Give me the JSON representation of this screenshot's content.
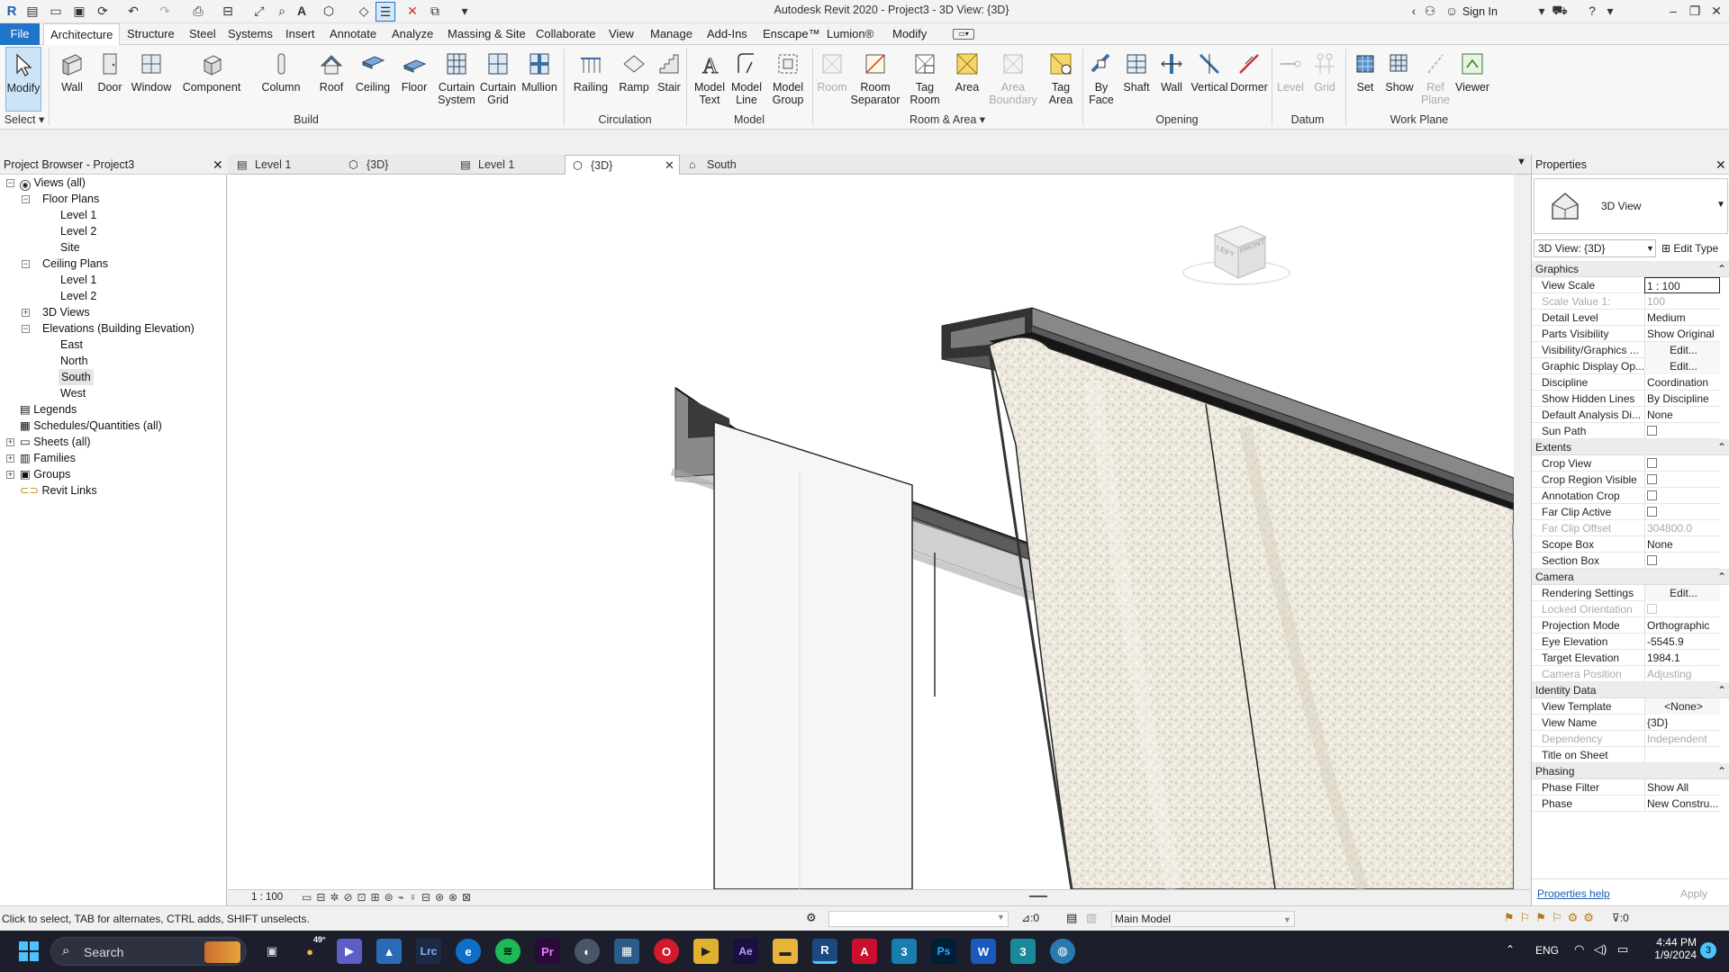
{
  "app": {
    "title": "Autodesk Revit 2020 - Project3 - 3D View: {3D}",
    "sign_in": "Sign In"
  },
  "menu": {
    "items": [
      "File",
      "Architecture",
      "Structure",
      "Steel",
      "Systems",
      "Insert",
      "Annotate",
      "Analyze",
      "Massing & Site",
      "Collaborate",
      "View",
      "Manage",
      "Add-Ins",
      "Enscape™",
      "Lumion®",
      "Modify"
    ]
  },
  "ribbon": {
    "buttons": [
      {
        "label": "Modify",
        "icon": "cursor-arrow-icon"
      },
      {
        "label": "Wall",
        "icon": "wall-icon"
      },
      {
        "label": "Door",
        "icon": "door-icon"
      },
      {
        "label": "Window",
        "icon": "window-icon"
      },
      {
        "label": "Component",
        "icon": "component-icon"
      },
      {
        "label": "Column",
        "icon": "column-icon"
      },
      {
        "label": "Roof",
        "icon": "roof-icon"
      },
      {
        "label": "Ceiling",
        "icon": "ceiling-icon"
      },
      {
        "label": "Floor",
        "icon": "floor-icon"
      },
      {
        "label": "Curtain\nSystem",
        "icon": "curtain-system-icon"
      },
      {
        "label": "Curtain\nGrid",
        "icon": "curtain-grid-icon"
      },
      {
        "label": "Mullion",
        "icon": "mullion-icon"
      },
      {
        "label": "Railing",
        "icon": "railing-icon"
      },
      {
        "label": "Ramp",
        "icon": "ramp-icon"
      },
      {
        "label": "Stair",
        "icon": "stair-icon"
      },
      {
        "label": "Model\nText",
        "icon": "model-text-icon"
      },
      {
        "label": "Model\nLine",
        "icon": "model-line-icon"
      },
      {
        "label": "Model\nGroup",
        "icon": "model-group-icon"
      },
      {
        "label": "Room",
        "icon": "room-icon"
      },
      {
        "label": "Room\nSeparator",
        "icon": "room-separator-icon"
      },
      {
        "label": "Tag\nRoom",
        "icon": "tag-room-icon"
      },
      {
        "label": "Area",
        "icon": "area-icon"
      },
      {
        "label": "Area\nBoundary",
        "icon": "area-boundary-icon"
      },
      {
        "label": "Tag\nArea",
        "icon": "tag-area-icon"
      },
      {
        "label": "By\nFace",
        "icon": "by-face-icon"
      },
      {
        "label": "Shaft",
        "icon": "shaft-icon"
      },
      {
        "label": "Wall",
        "icon": "wall-opening-icon"
      },
      {
        "label": "Vertical",
        "icon": "vertical-icon"
      },
      {
        "label": "Dormer",
        "icon": "dormer-icon"
      },
      {
        "label": "Level",
        "icon": "level-icon"
      },
      {
        "label": "Grid",
        "icon": "grid-icon"
      },
      {
        "label": "Set",
        "icon": "set-icon"
      },
      {
        "label": "Show",
        "icon": "show-icon"
      },
      {
        "label": "Ref\nPlane",
        "icon": "ref-plane-icon"
      },
      {
        "label": "Viewer",
        "icon": "viewer-icon"
      }
    ],
    "panels": [
      "Select",
      "Build",
      "Circulation",
      "Model",
      "Room & Area",
      "Opening",
      "Datum",
      "Work Plane"
    ]
  },
  "project_browser": {
    "title": "Project Browser - Project3",
    "items": [
      "Views (all)",
      "Floor Plans",
      "Level 1",
      "Level 2",
      "Site",
      "Ceiling Plans",
      "Level 1",
      "Level 2",
      "3D Views",
      "Elevations (Building Elevation)",
      "East",
      "North",
      "South",
      "West",
      "Legends",
      "Schedules/Quantities (all)",
      "Sheets (all)",
      "Families",
      "Groups",
      "Revit Links"
    ]
  },
  "tabs": [
    "Level 1",
    "{3D}",
    "Level 1",
    "{3D}",
    "South"
  ],
  "viewcube": {
    "left": "LEFT",
    "front": "FRONT"
  },
  "view_status": {
    "scale": "1 : 100"
  },
  "properties": {
    "title": "Properties",
    "type_name": "3D View",
    "selector": "3D View: {3D}",
    "edit_type": "Edit Type",
    "sections": {
      "graphics": "Graphics",
      "extents": "Extents",
      "camera": "Camera",
      "identity": "Identity Data",
      "phasing": "Phasing"
    },
    "rows": {
      "view_scale": {
        "name": "View Scale",
        "value": "1 : 100"
      },
      "scale_value": {
        "name": "Scale Value   1:",
        "value": "100"
      },
      "detail_level": {
        "name": "Detail Level",
        "value": "Medium"
      },
      "parts_visibility": {
        "name": "Parts Visibility",
        "value": "Show Original"
      },
      "vis_graphics": {
        "name": "Visibility/Graphics ...",
        "value": "Edit..."
      },
      "graphic_display": {
        "name": "Graphic Display Op...",
        "value": "Edit..."
      },
      "discipline": {
        "name": "Discipline",
        "value": "Coordination"
      },
      "hidden_lines": {
        "name": "Show Hidden Lines",
        "value": "By Discipline"
      },
      "default_analysis": {
        "name": "Default Analysis Di...",
        "value": "None"
      },
      "sun_path": {
        "name": "Sun Path",
        "value": ""
      },
      "crop_view": {
        "name": "Crop View",
        "value": ""
      },
      "crop_region": {
        "name": "Crop Region Visible",
        "value": ""
      },
      "annotation_crop": {
        "name": "Annotation Crop",
        "value": ""
      },
      "far_clip_active": {
        "name": "Far Clip Active",
        "value": ""
      },
      "far_clip_offset": {
        "name": "Far Clip Offset",
        "value": "304800.0"
      },
      "scope_box": {
        "name": "Scope Box",
        "value": "None"
      },
      "section_box": {
        "name": "Section Box",
        "value": ""
      },
      "rendering": {
        "name": "Rendering Settings",
        "value": "Edit..."
      },
      "locked_orientation": {
        "name": "Locked Orientation",
        "value": ""
      },
      "projection_mode": {
        "name": "Projection Mode",
        "value": "Orthographic"
      },
      "eye_elevation": {
        "name": "Eye Elevation",
        "value": "-5545.9"
      },
      "target_elevation": {
        "name": "Target Elevation",
        "value": "1984.1"
      },
      "camera_position": {
        "name": "Camera Position",
        "value": "Adjusting"
      },
      "view_template": {
        "name": "View Template",
        "value": "<None>"
      },
      "view_name": {
        "name": "View Name",
        "value": "{3D}"
      },
      "dependency": {
        "name": "Dependency",
        "value": "Independent"
      },
      "title_on_sheet": {
        "name": "Title on Sheet",
        "value": ""
      },
      "phase_filter": {
        "name": "Phase Filter",
        "value": "Show All"
      },
      "phase": {
        "name": "Phase",
        "value": "New Constru..."
      }
    },
    "help": "Properties help",
    "apply": "Apply"
  },
  "status": {
    "hint": "Click to select, TAB for alternates, CTRL adds, SHIFT unselects.",
    "count": ":0",
    "model": "Main Model",
    "filter_count": ":0"
  },
  "taskbar": {
    "search": "Search",
    "weather": "49°",
    "lang": "ENG",
    "time": "4:44 PM",
    "date": "1/9/2024",
    "notif": "3"
  }
}
